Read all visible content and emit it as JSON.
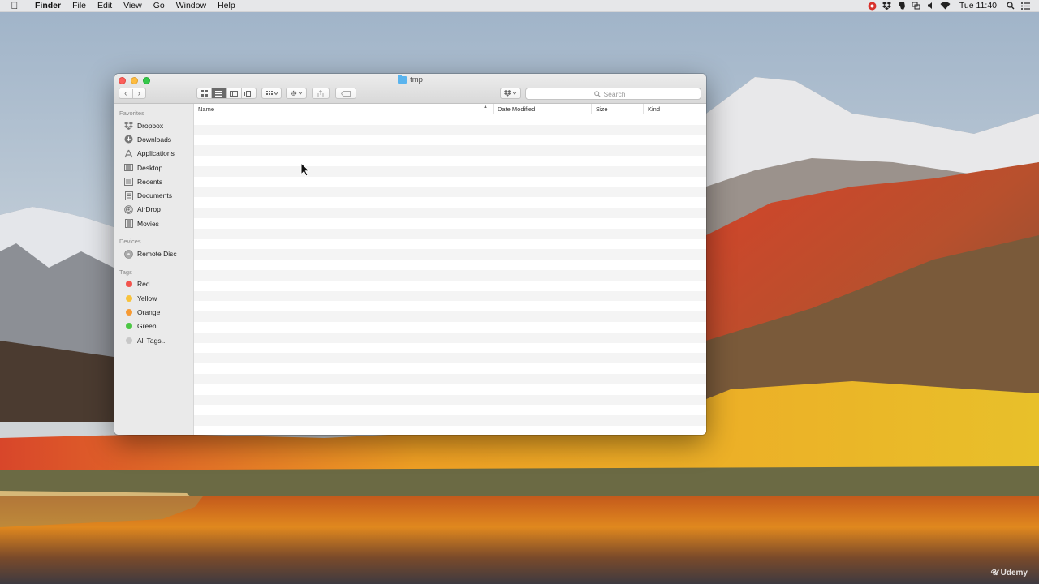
{
  "menubar": {
    "app_name": "Finder",
    "menus": [
      "File",
      "Edit",
      "View",
      "Go",
      "Window",
      "Help"
    ],
    "clock": "Tue 11:40",
    "status_icons": [
      "record-icon",
      "dropbox-icon",
      "evernote-icon",
      "display-icon",
      "volume-icon",
      "wifi-icon",
      "spotlight-icon",
      "notification-center-icon"
    ]
  },
  "window": {
    "title": "tmp",
    "search_placeholder": "Search",
    "columns": {
      "name": "Name",
      "date_modified": "Date Modified",
      "size": "Size",
      "kind": "Kind"
    },
    "sort_column": "Name",
    "view_mode": "list"
  },
  "sidebar": {
    "favorites_header": "Favorites",
    "favorites": [
      {
        "label": "Dropbox",
        "icon": "dropbox-icon"
      },
      {
        "label": "Downloads",
        "icon": "downloads-icon"
      },
      {
        "label": "Applications",
        "icon": "applications-icon"
      },
      {
        "label": "Desktop",
        "icon": "desktop-icon"
      },
      {
        "label": "Recents",
        "icon": "recents-icon"
      },
      {
        "label": "Documents",
        "icon": "documents-icon"
      },
      {
        "label": "AirDrop",
        "icon": "airdrop-icon"
      },
      {
        "label": "Movies",
        "icon": "movies-icon"
      }
    ],
    "devices_header": "Devices",
    "devices": [
      {
        "label": "Remote Disc",
        "icon": "remote-disc-icon"
      }
    ],
    "tags_header": "Tags",
    "tags": [
      {
        "label": "Red",
        "color": "#f2544d"
      },
      {
        "label": "Yellow",
        "color": "#f8c33c"
      },
      {
        "label": "Orange",
        "color": "#f69a34"
      },
      {
        "label": "Green",
        "color": "#4cc744"
      },
      {
        "label": "All Tags...",
        "color": "#c8c8c8"
      }
    ]
  },
  "watermark": "Udemy"
}
